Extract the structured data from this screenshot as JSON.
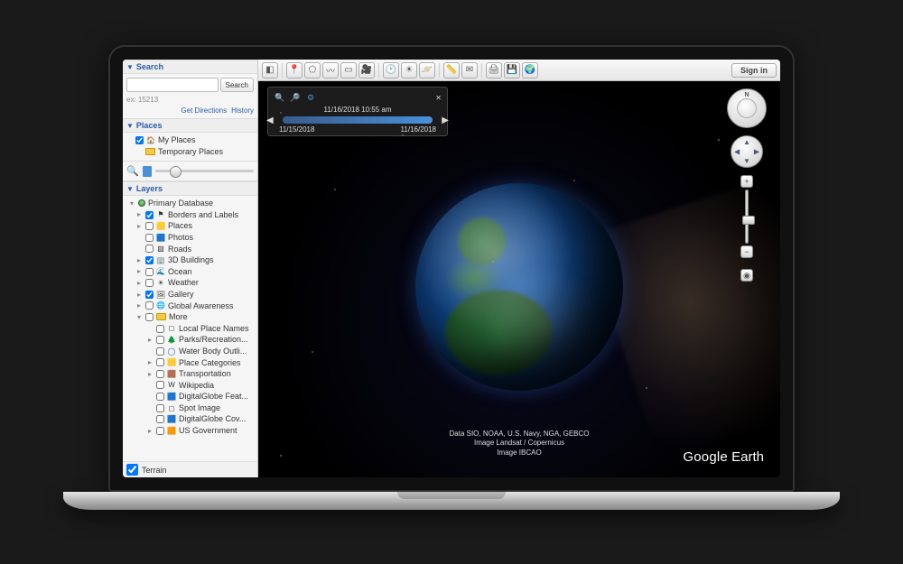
{
  "search": {
    "heading": "Search",
    "button": "Search",
    "placeholder": "",
    "hint": "ex: 15213",
    "directions": "Get Directions",
    "history": "History"
  },
  "places": {
    "heading": "Places",
    "my": "My Places",
    "temp": "Temporary Places"
  },
  "layers": {
    "heading": "Layers",
    "primary": "Primary Database",
    "items": {
      "borders": "Borders and Labels",
      "places": "Places",
      "photos": "Photos",
      "roads": "Roads",
      "buildings": "3D Buildings",
      "ocean": "Ocean",
      "weather": "Weather",
      "gallery": "Gallery",
      "awareness": "Global Awareness",
      "more": "More"
    },
    "more_items": {
      "local": "Local Place Names",
      "parks": "Parks/Recreation...",
      "water": "Water Body Outli...",
      "categories": "Place Categories",
      "transport": "Transportation",
      "wiki": "Wikipedia",
      "dg_feat": "DigitalGlobe Feat...",
      "spot": "Spot Image",
      "dg_cov": "DigitalGlobe Cov...",
      "usgov": "US Government"
    },
    "terrain": "Terrain"
  },
  "toolbar": {
    "signin": "Sign in"
  },
  "time": {
    "label": "11/16/2018  10:55 am",
    "start": "11/15/2018",
    "end": "11/16/2018"
  },
  "attribution": {
    "l1": "Data SIO, NOAA, U.S. Navy, NGA, GEBCO",
    "l2": "Image Landsat / Copernicus",
    "l3": "Image IBCAO"
  },
  "brand": {
    "g": "Google",
    "e": " Earth"
  }
}
